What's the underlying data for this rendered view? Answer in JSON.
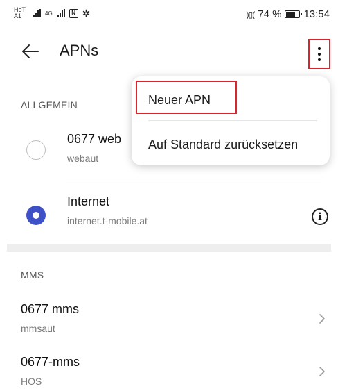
{
  "status_bar": {
    "carrier_line1": "HoT",
    "carrier_line2": "A1",
    "network_label": "4G",
    "nfc_label": "N",
    "battery_text": "74 %",
    "battery_level": 0.74,
    "time": "13:54"
  },
  "app_bar": {
    "title": "APNs"
  },
  "general": {
    "header": "ALLGEMEIN",
    "items": [
      {
        "name": "0677 web",
        "apn": "webaut",
        "selected": false
      },
      {
        "name": "Internet",
        "apn": "internet.t-mobile.at",
        "selected": true
      }
    ]
  },
  "mms": {
    "header": "MMS",
    "items": [
      {
        "name": "0677 mms",
        "apn": "mmsaut"
      },
      {
        "name": "0677-mms",
        "apn": "HOS"
      }
    ]
  },
  "menu": {
    "new_apn": "Neuer APN",
    "reset": "Auf Standard zurücksetzen"
  },
  "colors": {
    "accent": "#3f51c7",
    "highlight": "#d6262c"
  },
  "icons": [
    "back-arrow-icon",
    "more-vert-icon",
    "info-icon",
    "chevron-right-icon",
    "gear-icon",
    "nfc-icon",
    "battery-icon",
    "signal-icon"
  ]
}
